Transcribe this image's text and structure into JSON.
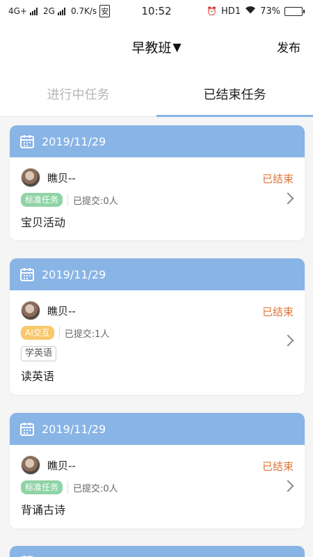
{
  "status_bar": {
    "net1": "4G+",
    "net2": "2G",
    "speed": "0.7K/s",
    "speed_icon": "安",
    "time": "10:52",
    "alarm": "⏰",
    "hd": "HD1",
    "battery_text": "73%",
    "battery_level": 0.73
  },
  "header": {
    "title": "早教班",
    "dropdown": "▼",
    "publish_label": "发布"
  },
  "tabs": [
    {
      "label": "进行中任务"
    },
    {
      "label": "已结束任务"
    }
  ],
  "cards": [
    {
      "date": "2019/11/29",
      "user": "瞧贝--",
      "state": "已结束",
      "badge": "标准任务",
      "submitted": "已提交:0人",
      "tag": "",
      "title": "宝贝活动"
    },
    {
      "date": "2019/11/29",
      "user": "瞧贝--",
      "state": "已结束",
      "badge": "AI交互",
      "submitted": "已提交:1人",
      "tag": "学英语",
      "title": "读英语"
    },
    {
      "date": "2019/11/29",
      "user": "瞧贝--",
      "state": "已结束",
      "badge": "标准任务",
      "submitted": "已提交:0人",
      "tag": "",
      "title": "背诵古诗"
    }
  ],
  "colors": {
    "accent": "#89b4e6",
    "state": "#e0743a",
    "badge_standard": "#8fd3a6",
    "badge_ai": "#f9c86b"
  }
}
